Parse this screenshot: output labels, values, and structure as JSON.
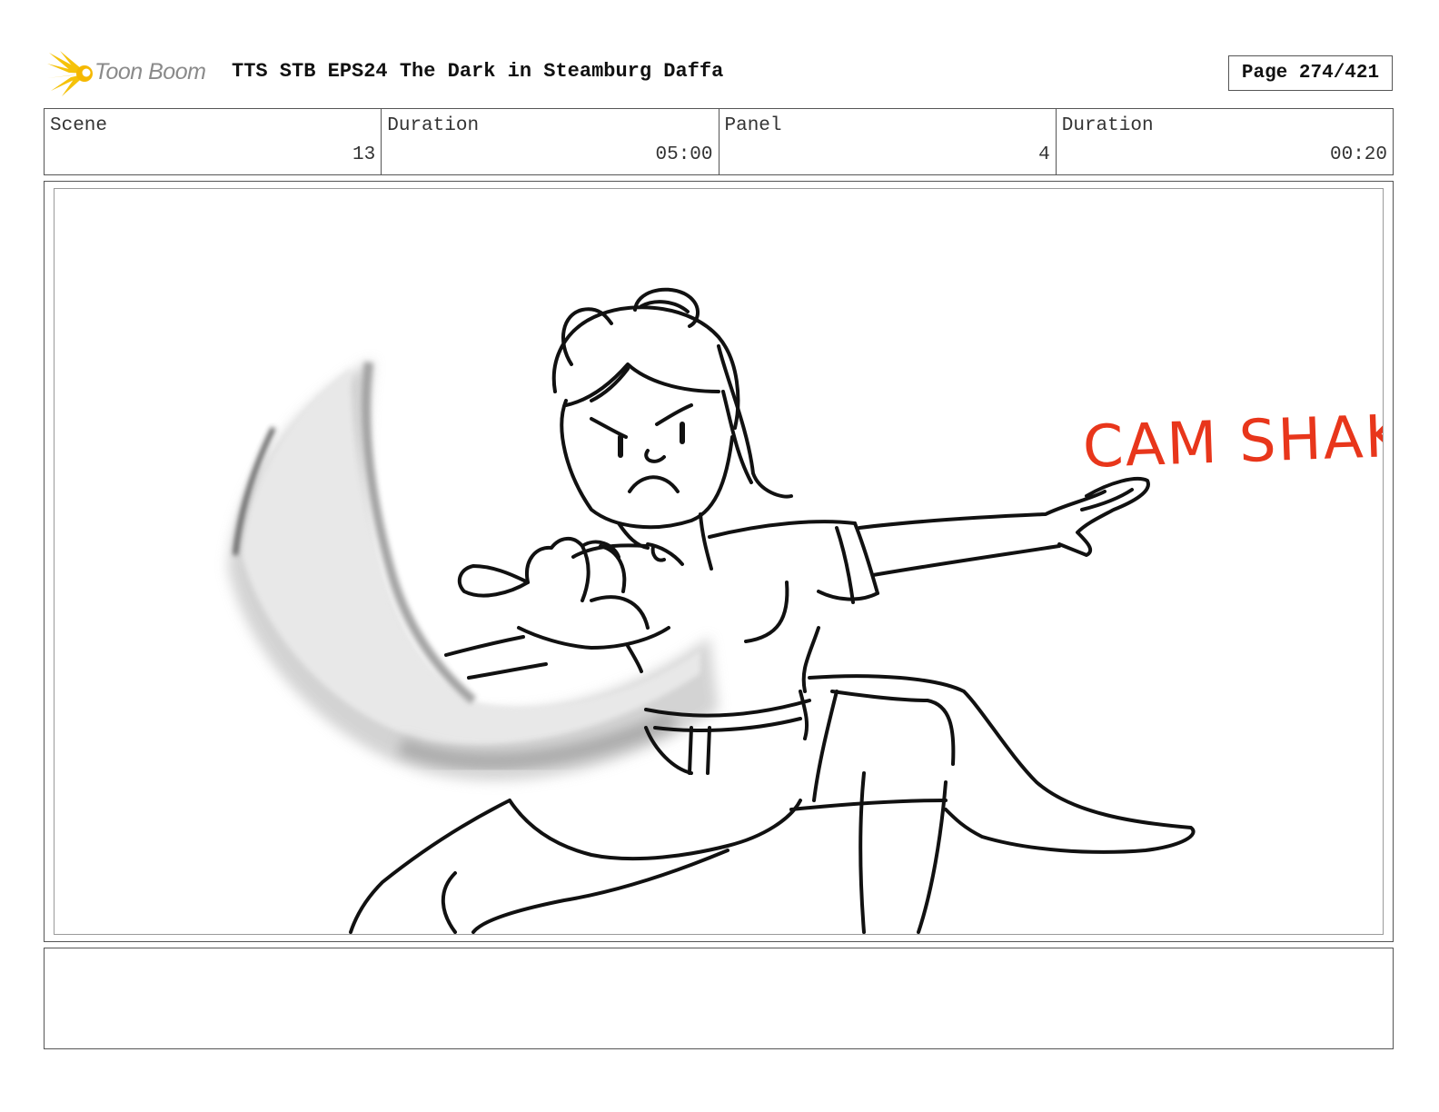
{
  "header": {
    "logo_text": "Toon Boom",
    "title": "TTS STB EPS24 The Dark in Steamburg Daffa",
    "page_label": "Page 274/421"
  },
  "info": {
    "scene_label": "Scene",
    "scene_value": "13",
    "scene_duration_label": "Duration",
    "scene_duration_value": "05:00",
    "panel_label": "Panel",
    "panel_value": "4",
    "panel_duration_label": "Duration",
    "panel_duration_value": "00:20"
  },
  "panel": {
    "annotation": "CAM SHAKE",
    "annotation_color": "#e8361b"
  },
  "notes": {
    "text": ""
  },
  "colors": {
    "logo_yellow": "#f5c20a",
    "logo_text": "#8a8a8a",
    "border": "#555555"
  }
}
